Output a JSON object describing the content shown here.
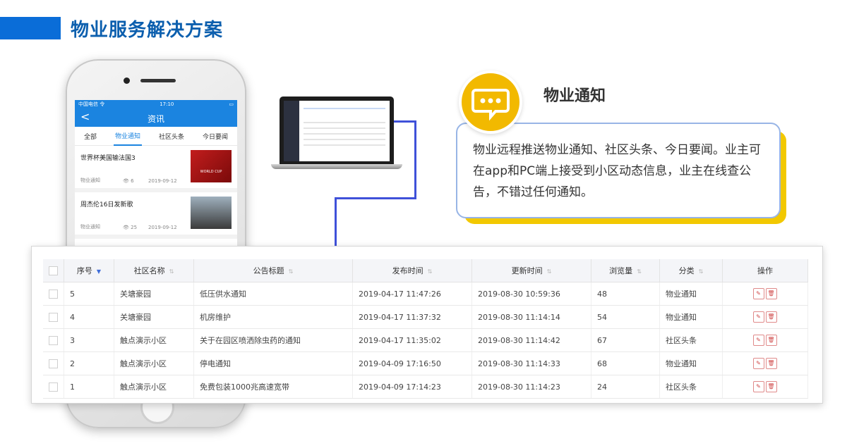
{
  "header": {
    "title": "物业服务解决方案"
  },
  "phone": {
    "status_carrier": "中国电信 令",
    "status_time": "17:10",
    "nav_back": "<",
    "nav_title": "资讯",
    "tabs": [
      "全部",
      "物业通知",
      "社区头条",
      "今日要闻"
    ],
    "news": [
      {
        "title": "世界杯美国输法国3",
        "category": "物业通知",
        "views": "6",
        "date": "2019-09-12",
        "thumb_text": "WORLD CUP"
      },
      {
        "title": "周杰伦16日发新歌",
        "category": "物业通知",
        "views": "25",
        "date": "2019-09-12"
      }
    ]
  },
  "card": {
    "title": "物业通知",
    "body": "物业远程推送物业通知、社区头条、今日要闻。业主可在app和PC端上接受到小区动态信息，业主在线查公告，不错过任何通知。"
  },
  "table": {
    "columns": [
      "序号",
      "社区名称",
      "公告标题",
      "发布时间",
      "更新时间",
      "浏览量",
      "分类",
      "操作"
    ],
    "rows": [
      [
        "5",
        "关塘豪园",
        "低压供水通知",
        "2019-04-17 11:47:26",
        "2019-08-30 10:59:36",
        "48",
        "物业通知"
      ],
      [
        "4",
        "关塘豪园",
        "机房维护",
        "2019-04-17 11:37:32",
        "2019-08-30 11:14:14",
        "54",
        "物业通知"
      ],
      [
        "3",
        "触点演示小区",
        "关于在园区喷洒除虫药的通知",
        "2019-04-17 11:35:02",
        "2019-08-30 11:14:42",
        "67",
        "社区头条"
      ],
      [
        "2",
        "触点演示小区",
        "停电通知",
        "2019-04-09 17:16:50",
        "2019-08-30 11:14:33",
        "68",
        "物业通知"
      ],
      [
        "1",
        "触点演示小区",
        "免费包装1000兆高速宽带",
        "2019-04-09 17:14:23",
        "2019-08-30 11:14:23",
        "24",
        "社区头条"
      ]
    ]
  },
  "colors": {
    "brand_blue": "#0a6dd8",
    "accent_yellow": "#f2b900",
    "connector": "#3f51d9"
  }
}
